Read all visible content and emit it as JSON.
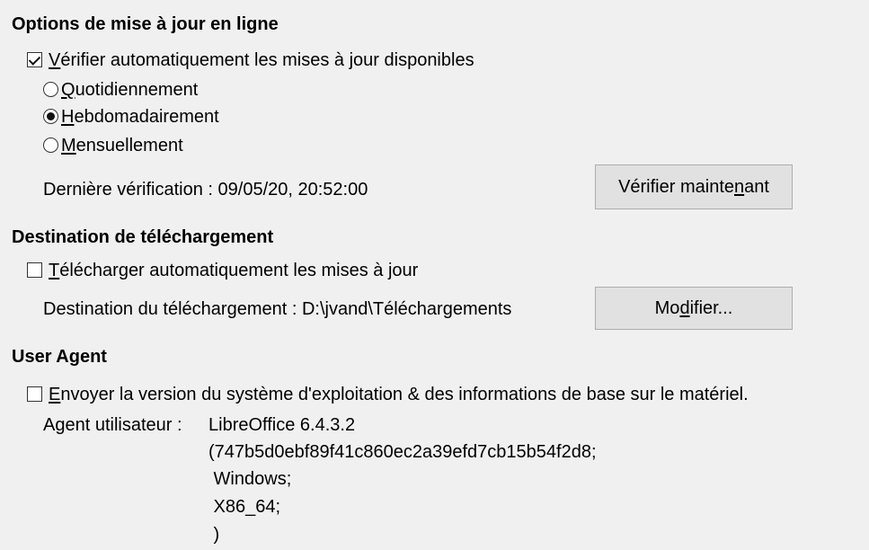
{
  "online_update": {
    "heading": "Options de mise à jour en ligne",
    "auto_check": {
      "checked": true,
      "mnemonic": "V",
      "rest": "érifier automatiquement les mises à jour disponibles"
    },
    "frequency": [
      {
        "mnemonic": "Q",
        "rest": "uotidiennement",
        "selected": false
      },
      {
        "mnemonic": "H",
        "rest": "ebdomadairement",
        "selected": true
      },
      {
        "mnemonic": "M",
        "rest": "ensuellement",
        "selected": false
      }
    ],
    "last_check_label": "Dernière vérification :",
    "last_check_value": "09/05/20, 20:52:00",
    "check_now_button": {
      "pre": "Vérifier mainte",
      "mnemonic": "n",
      "post": "ant"
    }
  },
  "download_destination": {
    "heading": "Destination de téléchargement",
    "auto_download": {
      "checked": false,
      "mnemonic": "T",
      "rest": "élécharger automatiquement les mises à jour"
    },
    "destination_label": "Destination du téléchargement :",
    "destination_value": "D:\\jvand\\Téléchargements",
    "modify_button": {
      "pre": "Mo",
      "mnemonic": "d",
      "post": "ifier..."
    }
  },
  "user_agent": {
    "heading": "User Agent",
    "send_info": {
      "checked": false,
      "mnemonic": "E",
      "rest": "nvoyer la version du système d'exploitation & des informations de base sur le matériel."
    },
    "agent_label": "Agent utilisateur :",
    "agent_lines": [
      "LibreOffice 6.4.3.2",
      "(747b5d0ebf89f41c860ec2a39efd7cb15b54f2d8;",
      " Windows;",
      " X86_64;",
      " )"
    ]
  }
}
